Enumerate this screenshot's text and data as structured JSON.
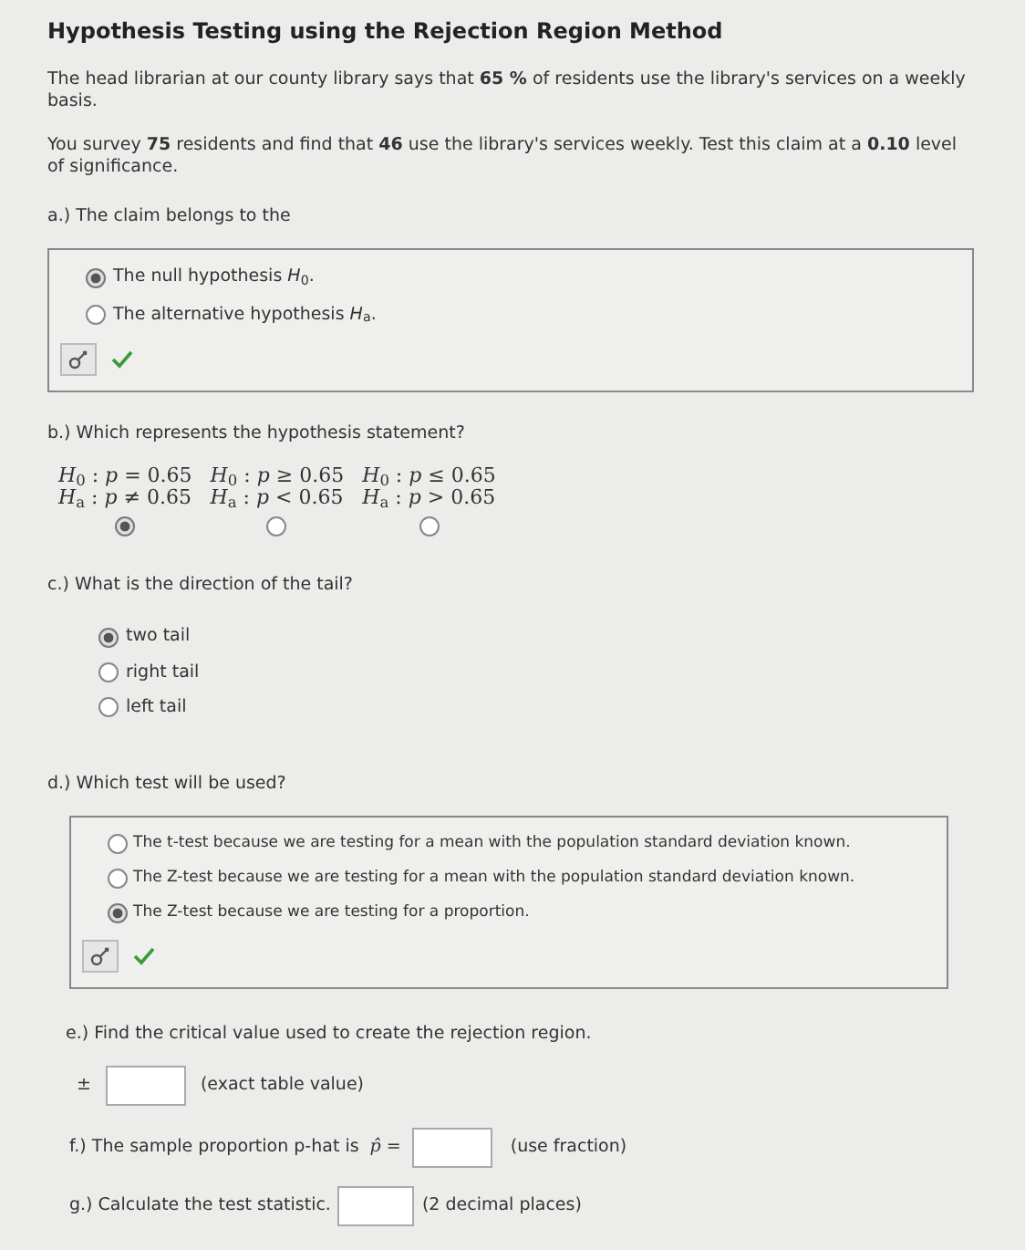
{
  "title": "Hypothesis Testing using the Rejection Region Method",
  "paragraphs": [
    "The head librarian at our county library says that **65 %** of residents use the library's services on a weekly basis.",
    "You survey **75** residents and find that **46** use the library's services weekly. Test this claim at a **0.10** level of significance."
  ],
  "part_a": {
    "question": "a.) The claim belongs to the",
    "options": [
      {
        "label": "The null hypothesis *H*$_{0}$.",
        "selected": true
      },
      {
        "label": "The alternative hypothesis *H*$_{a}$.",
        "selected": false
      }
    ],
    "correct": true
  },
  "part_b": {
    "question": "b.) Which represents the hypothesis statement?",
    "options": [
      {
        "null": "*H*$_{0}$ : *p* = 0.65",
        "alt": "*H*$_{a}$ : *p* ≠ 0.65",
        "selected": true
      },
      {
        "null": "*H*$_{0}$ : *p* ≥ 0.65",
        "alt": "*H*$_{a}$ : *p* < 0.65",
        "selected": false
      },
      {
        "null": "*H*$_{0}$ : *p* ≤ 0.65",
        "alt": "*H*$_{a}$ : *p* > 0.65",
        "selected": false
      }
    ]
  },
  "part_c": {
    "question": "c.) What is the direction of the tail?",
    "options": [
      {
        "label": "two tail",
        "selected": true
      },
      {
        "label": "right tail",
        "selected": false
      },
      {
        "label": "left tail",
        "selected": false
      }
    ]
  },
  "part_d": {
    "question": "d.) Which test will be used?",
    "options": [
      {
        "label": "The t-test because we are testing for a mean with the population standard deviation known.",
        "selected": false
      },
      {
        "label": "The Z-test because we are testing for a mean with the population standard deviation known.",
        "selected": false
      },
      {
        "label": "The Z-test because we are testing for a proportion.",
        "selected": true
      }
    ],
    "correct": true
  },
  "part_e": {
    "question": "e.) Find the critical value used to create the rejection region.",
    "prefix": "±",
    "hint": "(exact table value)"
  },
  "part_f": {
    "question": "f.) The sample proportion p-hat is",
    "symbol": "p̂ =",
    "hint": "(use fraction)"
  },
  "part_g": {
    "question": "g.) Calculate the test statistic.",
    "hint": "(2 decimal places)"
  }
}
